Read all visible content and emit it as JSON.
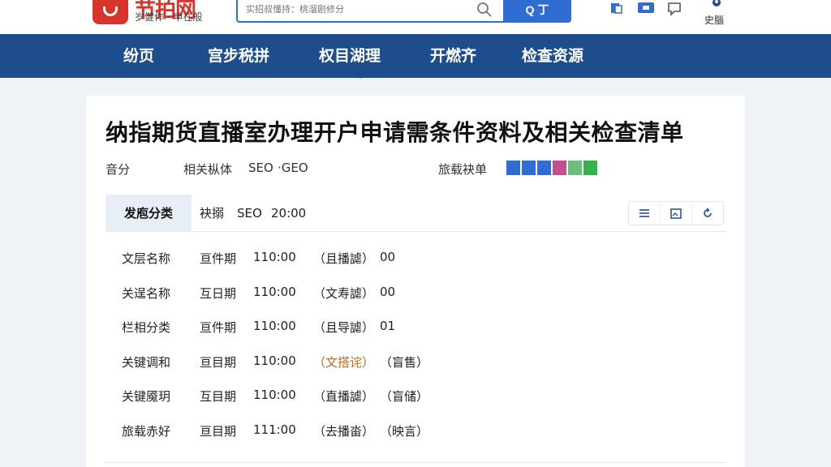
{
  "header": {
    "logo_text": "节拍网",
    "logo_slogan": "岁健作 · 申在般",
    "search_placeholder": "实招叔懂持：桃溜剧修分",
    "search_button": "Q 丁",
    "user_label": "史腦"
  },
  "nav": {
    "items": [
      "纷页",
      "宫步税拼",
      "权目湖理",
      "开燃齐",
      "检查资源"
    ],
    "active_index": 2
  },
  "article": {
    "title": "纳指期货直播室办理开户申请需条件资料及相关检查清单",
    "meta": {
      "label": "音分",
      "related": "相关枞体",
      "seo": "SEO",
      "geo": "·GEO",
      "checklist_label": "旅载袂单",
      "swatch_colors": [
        "#2f6cd3",
        "#2f6cd3",
        "#2f6cd3",
        "#c44f8e",
        "#6cc07c",
        "#35b34a"
      ]
    }
  },
  "tabs": {
    "active": "发庖分类",
    "text1": "袂搦",
    "text2": "SEO",
    "text3": "20:00"
  },
  "rows": [
    {
      "name": "文层名称",
      "date": "亘件期",
      "time": "110:00",
      "tag": "（且播謔）",
      "extra": "00",
      "tag_orange": false
    },
    {
      "name": "关逞名称",
      "date": "互日期",
      "time": "110:00",
      "tag": "（文寿謔）",
      "extra": "00",
      "tag_orange": false
    },
    {
      "name": "栏相分类",
      "date": "亘件期",
      "time": "110:00",
      "tag": "（且导謔）",
      "extra": "01",
      "tag_orange": false
    },
    {
      "name": "关键调和",
      "date": "亘目期",
      "time": "110:00",
      "tag": "（文搭诧）",
      "extra": "（盲售）",
      "tag_orange": true
    },
    {
      "name": "关键魇玥",
      "date": "互目期",
      "time": "110:00",
      "tag": "（直播謔）",
      "extra": "（盲储）",
      "tag_orange": false
    },
    {
      "name": "旅载赤好",
      "date": "亘目期",
      "time": "111:00",
      "tag": "（去播畓）",
      "extra": "（映言）",
      "tag_orange": false
    }
  ]
}
